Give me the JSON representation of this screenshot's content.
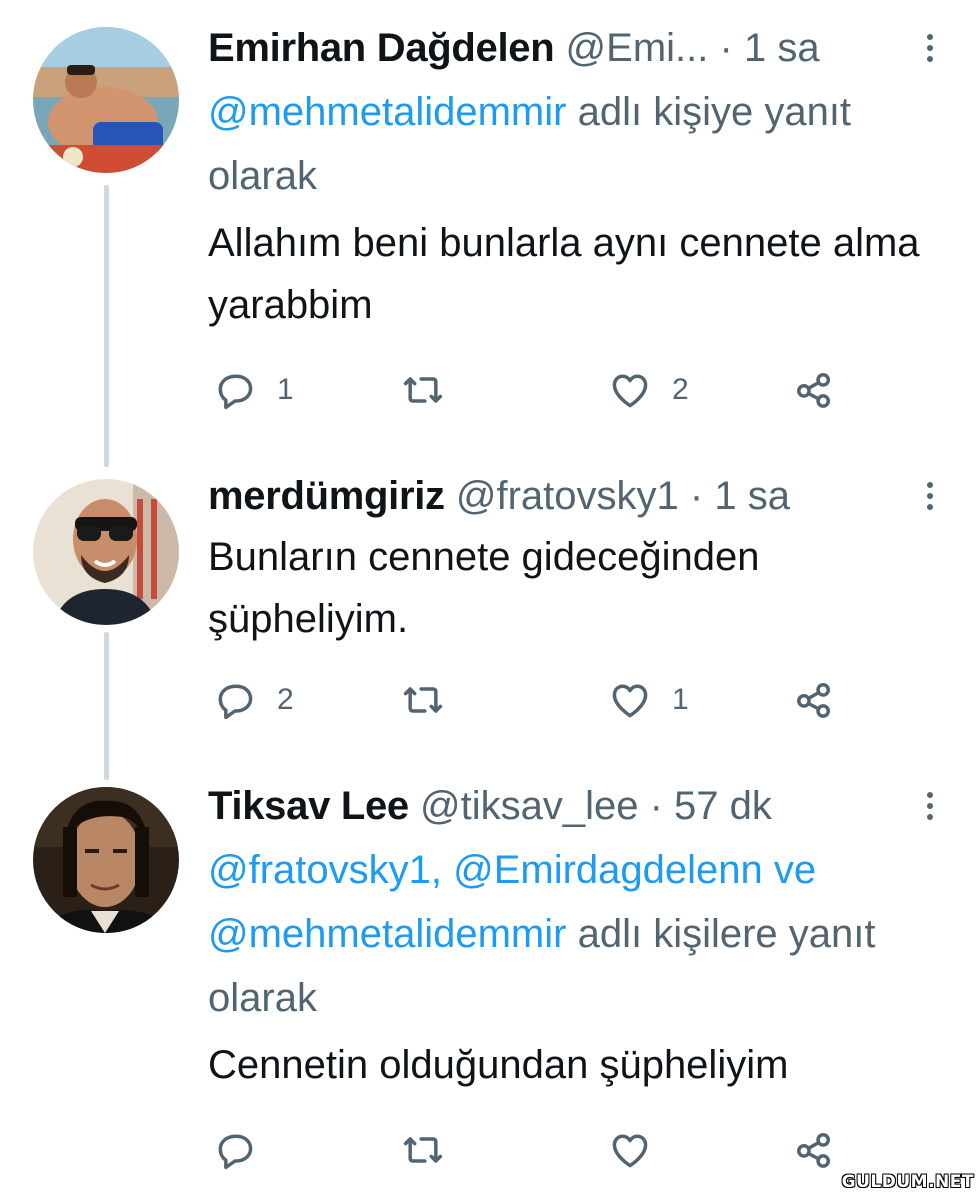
{
  "tweets": [
    {
      "name": "Emirhan Dağdelen",
      "handle": "@Emi...",
      "time": "1 sa",
      "reply_parts": [
        "@mehmetalidemmir",
        " adlı kişiye yanıt olarak"
      ],
      "text": "Allahım beni bunlarla aynı cennete alma yarabbim",
      "reply_count": "1",
      "retweet_count": "",
      "like_count": "2"
    },
    {
      "name": "merdümgiriz",
      "handle": "@fratovsky1",
      "time": "1 sa",
      "text": "Bunların cennete gideceğinden şüpheliyim.",
      "reply_count": "2",
      "retweet_count": "",
      "like_count": "1"
    },
    {
      "name": "Tiksav Lee",
      "handle": "@tiksav_lee",
      "time": "57 dk",
      "reply_parts": [
        "@fratovsky1, @Emirdagdelenn",
        " ve ",
        "@mehmetalidemmir",
        " adlı kişilere yanıt olarak"
      ],
      "text": "Cennetin olduğundan şüpheliyim",
      "reply_count": "",
      "retweet_count": "",
      "like_count": ""
    }
  ],
  "separator": "·",
  "watermark": "GULDUM.NET",
  "icons": [
    "reply-icon",
    "retweet-icon",
    "like-icon",
    "share-icon",
    "more-icon"
  ],
  "colors": {
    "text": "#0f1419",
    "muted": "#536471",
    "link": "#1d9bf0",
    "thread": "#cfd9de"
  }
}
